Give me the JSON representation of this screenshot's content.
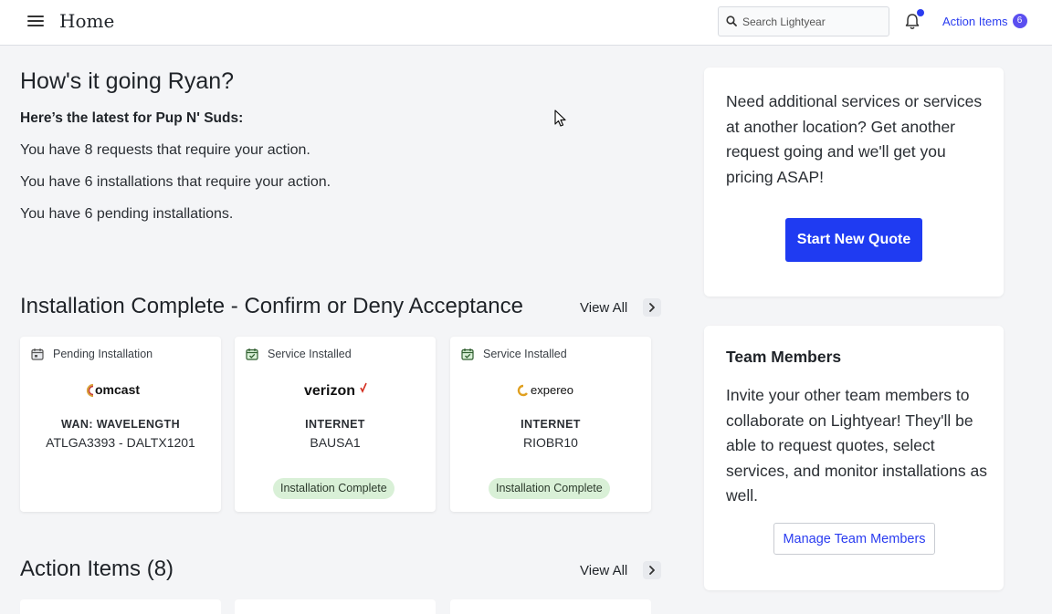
{
  "header": {
    "page_title": "Home",
    "search_placeholder": "Search Lightyear",
    "action_items_label": "Action Items",
    "action_items_count": "6"
  },
  "greeting": {
    "title": "How's it going Ryan?",
    "latest": "Here’s the latest for Pup N' Suds:",
    "lines": [
      "You have 8 requests that require your action.",
      "You have 6 installations that require your action.",
      "You have 6 pending installations."
    ]
  },
  "installations": {
    "title": "Installation Complete - Confirm or Deny Acceptance",
    "view_all": "View All",
    "cards": [
      {
        "status": "Pending Installation",
        "status_icon": "calendar-icon",
        "provider": "comcast",
        "type": "WAN: WAVELENGTH",
        "id": "ATLGA3393 - DALTX1201",
        "badge": ""
      },
      {
        "status": "Service Installed",
        "status_icon": "calendar-check-icon",
        "provider": "verizon",
        "type": "INTERNET",
        "id": "BAUSA1",
        "badge": "Installation Complete"
      },
      {
        "status": "Service Installed",
        "status_icon": "calendar-check-icon",
        "provider": "expereo",
        "type": "INTERNET",
        "id": "RIOBR10",
        "badge": "Installation Complete"
      }
    ]
  },
  "action_items": {
    "title": "Action Items (8)",
    "view_all": "View All"
  },
  "quote_panel": {
    "text": "Need additional services or services at another location? Get another request going and we'll get you pricing ASAP!",
    "button": "Start New Quote"
  },
  "team_panel": {
    "heading": "Team Members",
    "text": "Invite your other team members to collaborate on Lightyear! They'll be able to request quotes, select services, and monitor installations as well.",
    "button": "Manage Team Members"
  },
  "colors": {
    "accent": "#1f3bf2",
    "link": "#2a3cf0",
    "badge_bg": "#d9f0d7",
    "background": "#f4f5f7"
  }
}
